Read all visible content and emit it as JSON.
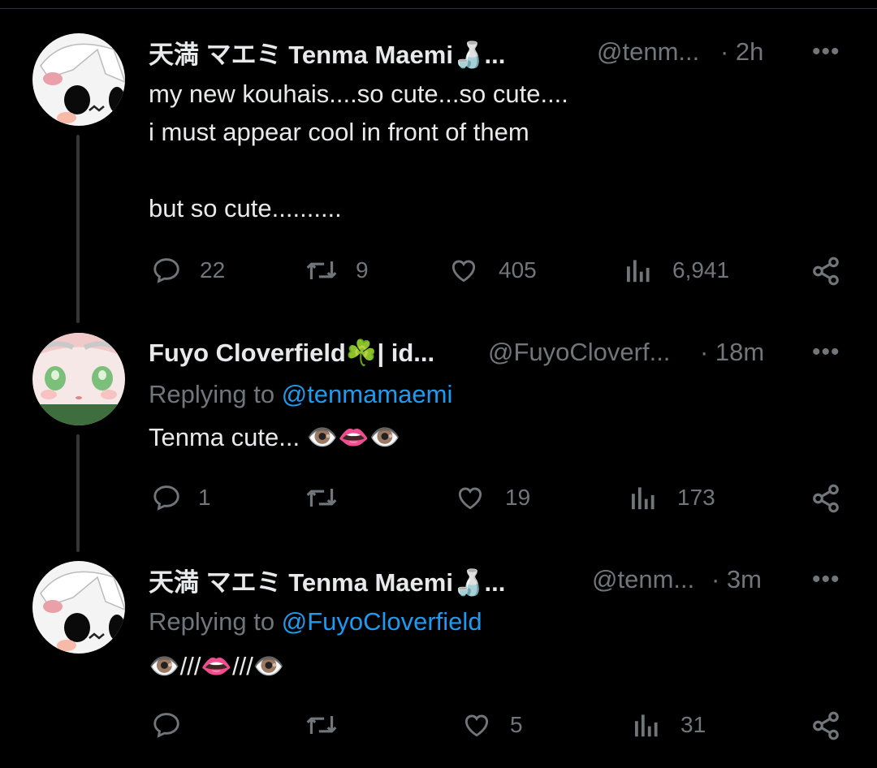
{
  "tweets": [
    {
      "name": "天満 マエミ Tenma Maemi🍶...",
      "handle": "@tenm...",
      "time": "· 2h",
      "more": "•••",
      "lines": [
        "my new kouhais....so cute...so cute....",
        "i must appear cool in front of them",
        "",
        "but so cute.........."
      ],
      "replies": "22",
      "retweets": "9",
      "likes": "405",
      "views": "6,941"
    },
    {
      "name": "Fuyo Cloverfield☘️| id...",
      "handle": "@FuyoCloverf...",
      "time": "· 18m",
      "more": "•••",
      "replying_label": "Replying to ",
      "replying_to": "@tenmamaemi",
      "text": "Tenma cute... 👁️👄👁️",
      "replies": "1",
      "retweets": "",
      "likes": "19",
      "views": "173"
    },
    {
      "name": "天満 マエミ Tenma Maemi🍶...",
      "handle": "@tenm...",
      "time": "· 3m",
      "more": "•••",
      "replying_label": "Replying to ",
      "replying_to": "@FuyoCloverfield",
      "text": "👁️///👄///👁️",
      "replies": "",
      "retweets": "",
      "likes": "5",
      "views": "31"
    }
  ],
  "icons": [
    "reply-icon",
    "retweet-icon",
    "like-icon",
    "views-icon",
    "share-icon"
  ],
  "colors": {
    "background": "#000000",
    "text": "#e7e9ea",
    "muted": "#71767b",
    "link": "#1d9bf0"
  }
}
